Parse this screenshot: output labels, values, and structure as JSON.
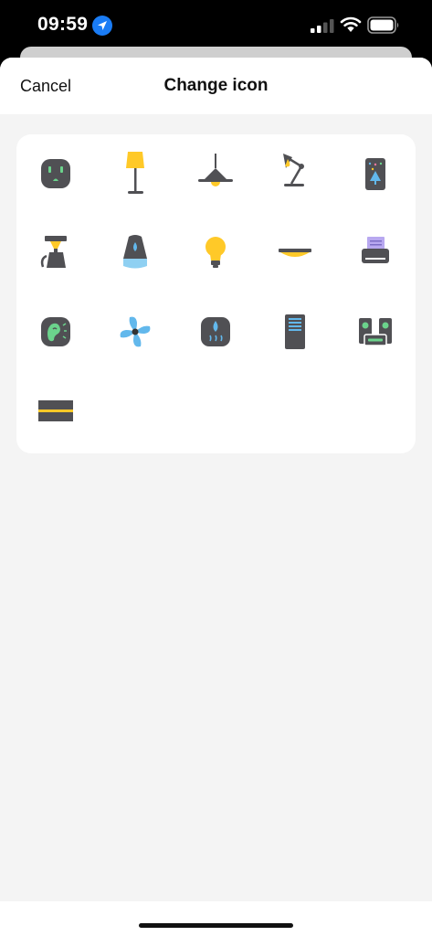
{
  "status_bar": {
    "time": "09:59",
    "icons": [
      "location-arrow-icon",
      "cellular-signal-icon",
      "wifi-icon",
      "battery-icon"
    ],
    "location_color": "#1a7cf5"
  },
  "nav": {
    "cancel_label": "Cancel",
    "title": "Change icon"
  },
  "icons": [
    "power-outlet-icon",
    "floor-lamp-icon",
    "ceiling-lamp-icon",
    "desk-lamp-icon",
    "christmas-lights-remote-icon",
    "coffee-maker-icon",
    "humidifier-icon",
    "light-bulb-icon",
    "ceiling-light-icon",
    "printer-icon",
    "hearing-aid-icon",
    "fan-icon",
    "dehumidifier-icon",
    "air-purifier-icon",
    "speakers-icon",
    "light-strip-icon"
  ],
  "colors": {
    "icon_dark": "#505054",
    "yellow": "#ffc928",
    "blue": "#62b8ec",
    "green": "#6bd38c",
    "purple": "#b8a8f0",
    "sheet_background": "#f4f4f4"
  }
}
